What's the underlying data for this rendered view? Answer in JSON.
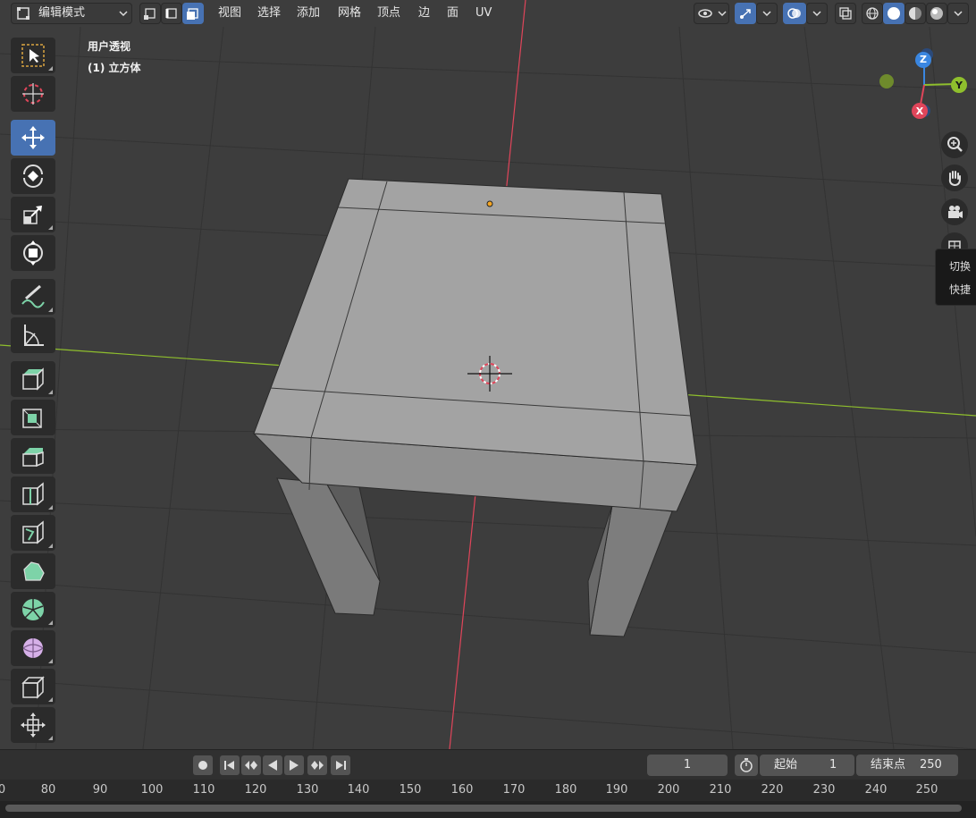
{
  "header": {
    "mode_label": "编辑模式",
    "menus": [
      "视图",
      "选择",
      "添加",
      "网格",
      "顶点",
      "边",
      "面",
      "UV"
    ]
  },
  "viewport": {
    "view_name": "用户透视",
    "object_name": "(1) 立方体"
  },
  "toolbar": {
    "tools": [
      {
        "name": "select-box",
        "icon": "select-box-icon",
        "active": false
      },
      {
        "name": "cursor",
        "icon": "cursor-icon",
        "active": false
      },
      {
        "name": "move",
        "icon": "move-icon",
        "active": true
      },
      {
        "name": "rotate",
        "icon": "rotate-icon",
        "active": false
      },
      {
        "name": "scale",
        "icon": "scale-icon",
        "active": false
      },
      {
        "name": "transform",
        "icon": "transform-icon",
        "active": false
      },
      {
        "name": "annotate",
        "icon": "annotate-icon",
        "active": false
      },
      {
        "name": "measure",
        "icon": "measure-icon",
        "active": false
      },
      {
        "name": "extrude",
        "icon": "extrude-icon",
        "active": false
      },
      {
        "name": "inset",
        "icon": "inset-icon",
        "active": false
      },
      {
        "name": "bevel",
        "icon": "bevel-icon",
        "active": false
      },
      {
        "name": "loop-cut",
        "icon": "loop-cut-icon",
        "active": false
      },
      {
        "name": "knife",
        "icon": "knife-icon",
        "active": false
      },
      {
        "name": "poly-build",
        "icon": "poly-build-icon",
        "active": false
      },
      {
        "name": "spin",
        "icon": "spin-icon",
        "active": false
      },
      {
        "name": "smooth",
        "icon": "smooth-icon",
        "active": false
      },
      {
        "name": "shear",
        "icon": "shear-icon",
        "active": false
      },
      {
        "name": "shrink-fatten",
        "icon": "shrink-fatten-icon",
        "active": false
      }
    ]
  },
  "gizmo": {
    "x": "X",
    "y": "Y",
    "z": "Z"
  },
  "tooltip": {
    "line1": "切换",
    "line2": "快捷"
  },
  "timeline": {
    "current_frame": "1",
    "start_label": "起始",
    "start_value": "1",
    "end_label": "结束点",
    "end_value": "250",
    "ticks": [
      "0",
      "80",
      "90",
      "100",
      "110",
      "120",
      "130",
      "140",
      "150",
      "160",
      "170",
      "180",
      "190",
      "200",
      "210",
      "220",
      "230",
      "240",
      "250"
    ]
  },
  "colors": {
    "accent": "#4772b3",
    "axis_x": "#e0455a",
    "axis_y": "#8fbf2d",
    "axis_z": "#3a86e0"
  }
}
